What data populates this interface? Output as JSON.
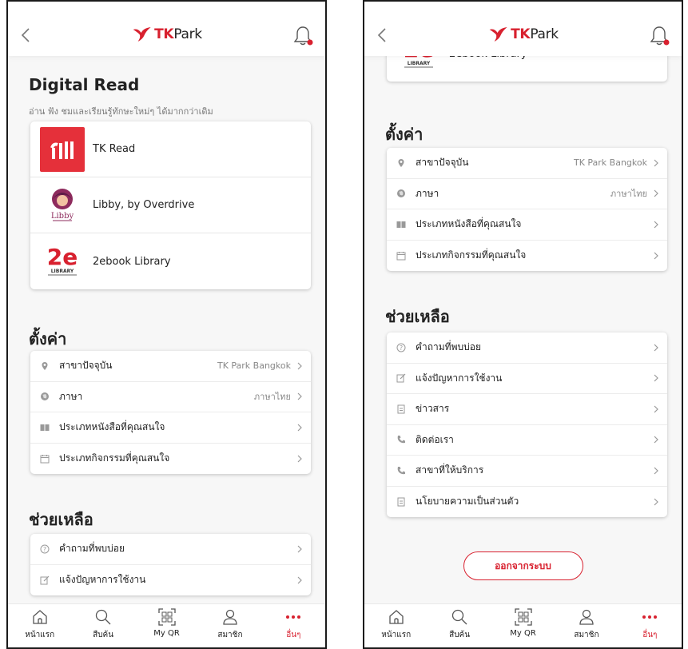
{
  "colors": {
    "accent": "#d8212f",
    "text": "#222222",
    "muted": "#888888"
  },
  "app": {
    "logo_tk": "TK",
    "logo_park": "Park"
  },
  "digital_read": {
    "title": "Digital Read",
    "subtitle": "อ่าน ฟัง ชมและเรียนรู้ทักษะใหม่ๆ ได้มากกว่าเดิม",
    "items": [
      {
        "label": "TK Read",
        "icon": "tk-read-logo"
      },
      {
        "label": "Libby, by Overdrive",
        "icon": "libby-logo",
        "icon_text": "Libby"
      },
      {
        "label": "2ebook Library",
        "icon": "2ebook-logo",
        "icon_text": "2e",
        "icon_subtext": "LIBRARY"
      }
    ]
  },
  "settings": {
    "title": "ตั้งค่า",
    "items": [
      {
        "label": "สาขาปัจจุบัน",
        "value": "TK Park Bangkok",
        "icon": "location-icon"
      },
      {
        "label": "ภาษา",
        "value": "ภาษาไทย",
        "icon": "globe-icon"
      },
      {
        "label": "ประเภทหนังสือที่คุณสนใจ",
        "value": "",
        "icon": "book-icon"
      },
      {
        "label": "ประเภทกิจกรรมที่คุณสนใจ",
        "value": "",
        "icon": "calendar-icon"
      }
    ]
  },
  "help": {
    "title": "ช่วยเหลือ",
    "items": [
      {
        "label": "คำถามที่พบบ่อย",
        "icon": "question-icon"
      },
      {
        "label": "แจ้งปัญหาการใช้งาน",
        "icon": "edit-icon"
      },
      {
        "label": "ข่าวสาร",
        "icon": "document-icon"
      },
      {
        "label": "ติดต่อเรา",
        "icon": "phone-icon"
      },
      {
        "label": "สาขาที่ให้บริการ",
        "icon": "phone-icon"
      },
      {
        "label": "นโยบายความเป็นส่วนตัว",
        "icon": "document-icon"
      }
    ]
  },
  "logout_label": "ออกจากระบบ",
  "bottom_nav": [
    {
      "label": "หน้าแรก",
      "icon": "home-icon"
    },
    {
      "label": "สืบค้น",
      "icon": "search-icon"
    },
    {
      "label": "My QR",
      "icon": "qr-icon"
    },
    {
      "label": "สมาชิก",
      "icon": "user-icon"
    },
    {
      "label": "อื่นๆ",
      "icon": "more-icon",
      "active": true
    }
  ]
}
